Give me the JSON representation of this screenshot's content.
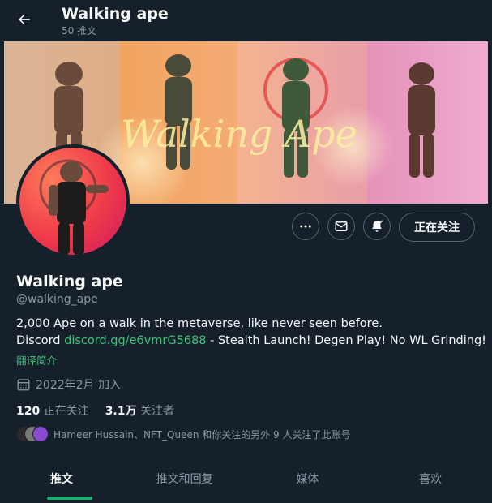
{
  "header": {
    "title": "Walking ape",
    "tweet_count": "50 推文"
  },
  "banner": {
    "script_text": "Walking Ape"
  },
  "profile": {
    "name": "Walking ape",
    "handle": "@walking_ape",
    "bio_line1": "2,000 Ape on a walk in the metaverse, like never seen before.",
    "bio_line2_prefix": "Discord ",
    "bio_link": "discord.gg/e6vmrG5688",
    "bio_line2_suffix": " - Stealth Launch! Degen Play! No WL Grinding!",
    "translate_label": "翻译简介",
    "joined": "2022年2月 加入",
    "following_count": "120",
    "following_label": "正在关注",
    "followers_count": "3.1万",
    "followers_label": "关注者",
    "followed_by": "Hameer Hussain、NFT_Queen 和你关注的另外 9 人关注了此账号"
  },
  "actions": {
    "follow_label": "正在关注"
  },
  "tabs": [
    {
      "label": "推文",
      "active": true
    },
    {
      "label": "推文和回复",
      "active": false
    },
    {
      "label": "媒体",
      "active": false
    },
    {
      "label": "喜欢",
      "active": false
    }
  ],
  "colors": {
    "background": "#15202b",
    "accent_green": "#3ec17b",
    "tab_indicator": "#1dad6a"
  }
}
